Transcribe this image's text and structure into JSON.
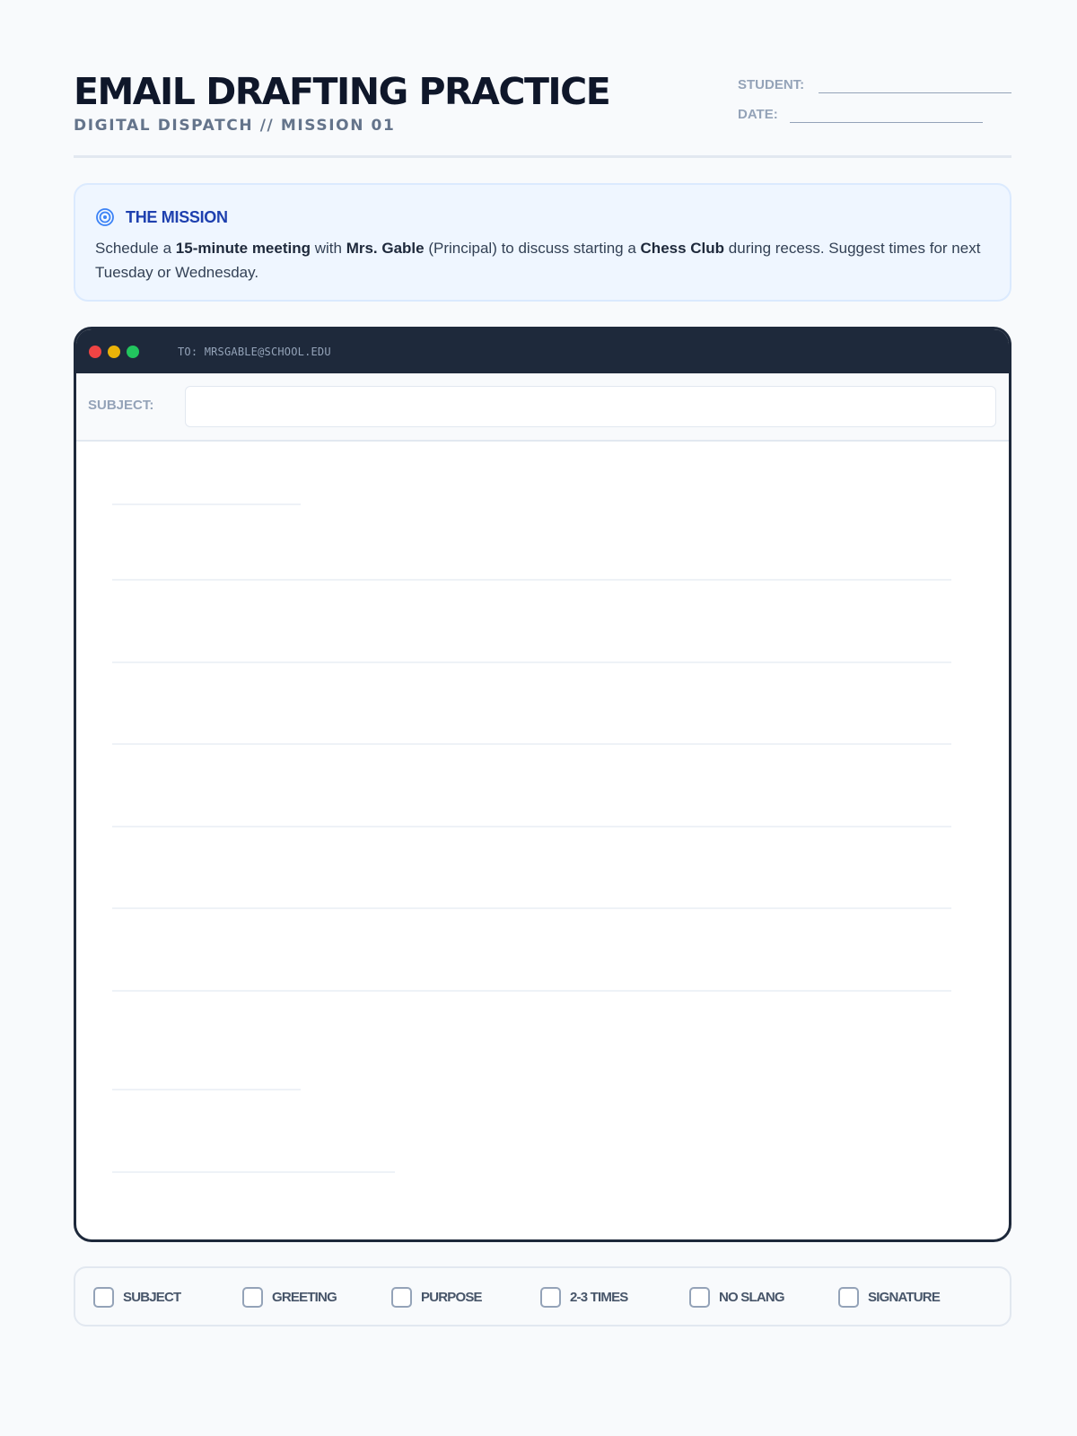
{
  "header": {
    "title": "EMAIL DRAFTING PRACTICE",
    "subtitle": "DIGITAL DISPATCH // MISSION 01",
    "student_label": "STUDENT:",
    "date_label": "DATE:"
  },
  "mission": {
    "icon": "target-icon",
    "heading": "THE MISSION",
    "text_parts": {
      "p1": "Schedule a ",
      "b1": "15-minute meeting",
      "p2": " with ",
      "b2": "Mrs. Gable",
      "p3": " (Principal) to discuss starting a ",
      "b3": "Chess Club",
      "p4": " during recess. Suggest times for next Tuesday or Wednesday."
    }
  },
  "email": {
    "to": "TO: MRSGABLE@SCHOOL.EDU",
    "subject_label": "SUBJECT:",
    "subject_value": "",
    "colors": {
      "titlebar": "#1e293b",
      "dot_red": "#ef4444",
      "dot_yellow": "#eab308",
      "dot_green": "#22c55e"
    }
  },
  "checklist": {
    "items": [
      "SUBJECT",
      "GREETING",
      "PURPOSE",
      "2-3 TIMES",
      "NO SLANG",
      "SIGNATURE"
    ]
  }
}
